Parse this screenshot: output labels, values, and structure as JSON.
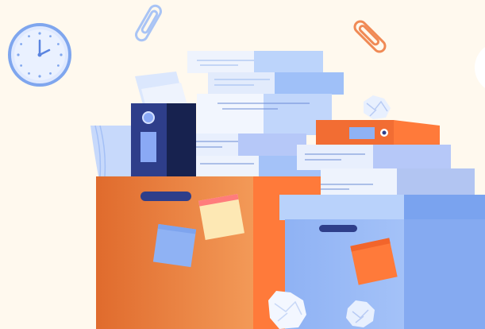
{
  "scene": {
    "subject": "office-paperwork-illustration",
    "colors": {
      "background": "#fff9ee",
      "orange": "#f2853c",
      "orange_dark": "#e4682a",
      "blue_light": "#b9d2fb",
      "blue_mid": "#8fb2f4",
      "navy": "#2e3e8a",
      "paper": "#eef3fd",
      "sticky_yellow": "#fde8b4",
      "sticky_pink": "#ff7c7c"
    },
    "icons": [
      "clock-icon",
      "paperclip-icon",
      "folder-icon",
      "binder-icon",
      "box-icon",
      "sticky-note-icon",
      "crumpled-paper-icon"
    ]
  }
}
